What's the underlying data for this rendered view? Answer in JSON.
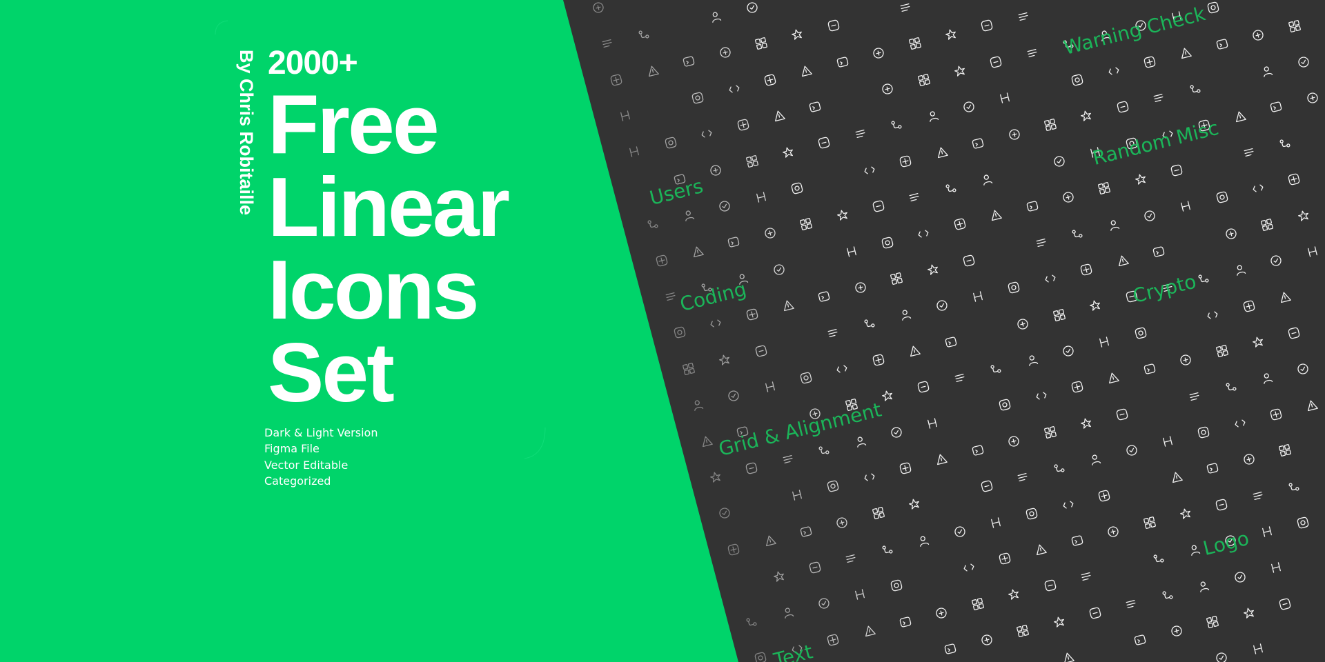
{
  "hero": {
    "count": "2000+",
    "title_lines": [
      "Free",
      "Linear",
      "Icons",
      "Set"
    ],
    "author": "By Chris Robitaille",
    "features": [
      "Dark & Light Version",
      "Figma File",
      "Vector Editable",
      "Categorized"
    ]
  },
  "categories": [
    {
      "label": "Warning Check"
    },
    {
      "label": "Random Misc"
    },
    {
      "label": "Users"
    },
    {
      "label": "Coding"
    },
    {
      "label": "Crypto"
    },
    {
      "label": "Grid & Alignment"
    },
    {
      "label": "Logo"
    },
    {
      "label": "Text"
    }
  ],
  "colors": {
    "green": "#00d46a",
    "dark": "#333333",
    "accent_text": "#19c45e",
    "icon_stroke": "#f2f2f2"
  }
}
